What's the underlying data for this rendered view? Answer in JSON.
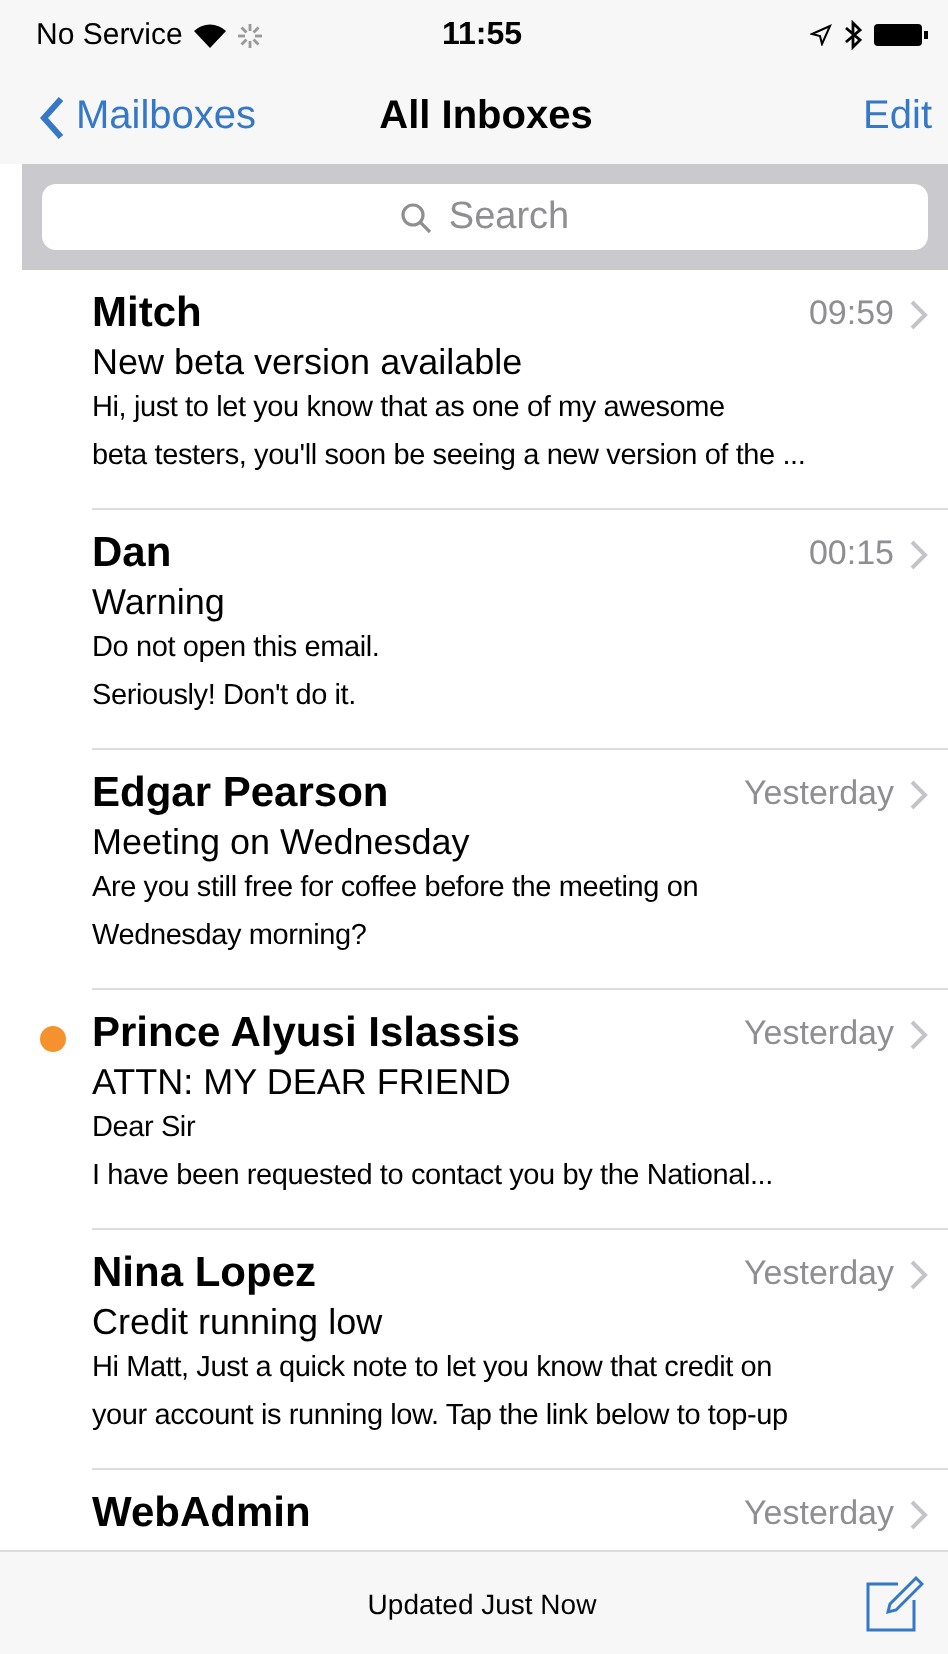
{
  "status_bar": {
    "carrier": "No Service",
    "time": "11:55"
  },
  "nav": {
    "back": "Mailboxes",
    "title": "All Inboxes",
    "action": "Edit"
  },
  "search": {
    "placeholder": "Search"
  },
  "messages": [
    {
      "sender": "Mitch",
      "time": "09:59",
      "unread": false,
      "subject": "New beta version available",
      "preview": [
        "Hi, just to let you know that as one of my awesome",
        "beta testers, you'll soon be seeing a new version of the ..."
      ]
    },
    {
      "sender": "Dan",
      "time": "00:15",
      "unread": false,
      "subject": "Warning",
      "preview": [
        "Do not open this email.",
        "Seriously! Don't do it."
      ]
    },
    {
      "sender": "Edgar Pearson",
      "time": "Yesterday",
      "unread": false,
      "subject": "Meeting on Wednesday",
      "preview": [
        "Are you still free for coffee before the meeting on",
        "Wednesday morning?"
      ]
    },
    {
      "sender": "Prince Alyusi Islassis",
      "time": "Yesterday",
      "unread": true,
      "subject": "ATTN: MY DEAR FRIEND",
      "preview": [
        "Dear Sir",
        "I have been requested to contact you by the National..."
      ]
    },
    {
      "sender": "Nina Lopez",
      "time": "Yesterday",
      "unread": false,
      "subject": "Credit running low",
      "preview": [
        "Hi Matt, Just a quick note to let you know that credit on",
        "your account is running low. Tap the link below to top-up"
      ]
    },
    {
      "sender": "WebAdmin",
      "time": "Yesterday",
      "unread": false
    }
  ],
  "toolbar": {
    "status": "Updated Just Now"
  }
}
